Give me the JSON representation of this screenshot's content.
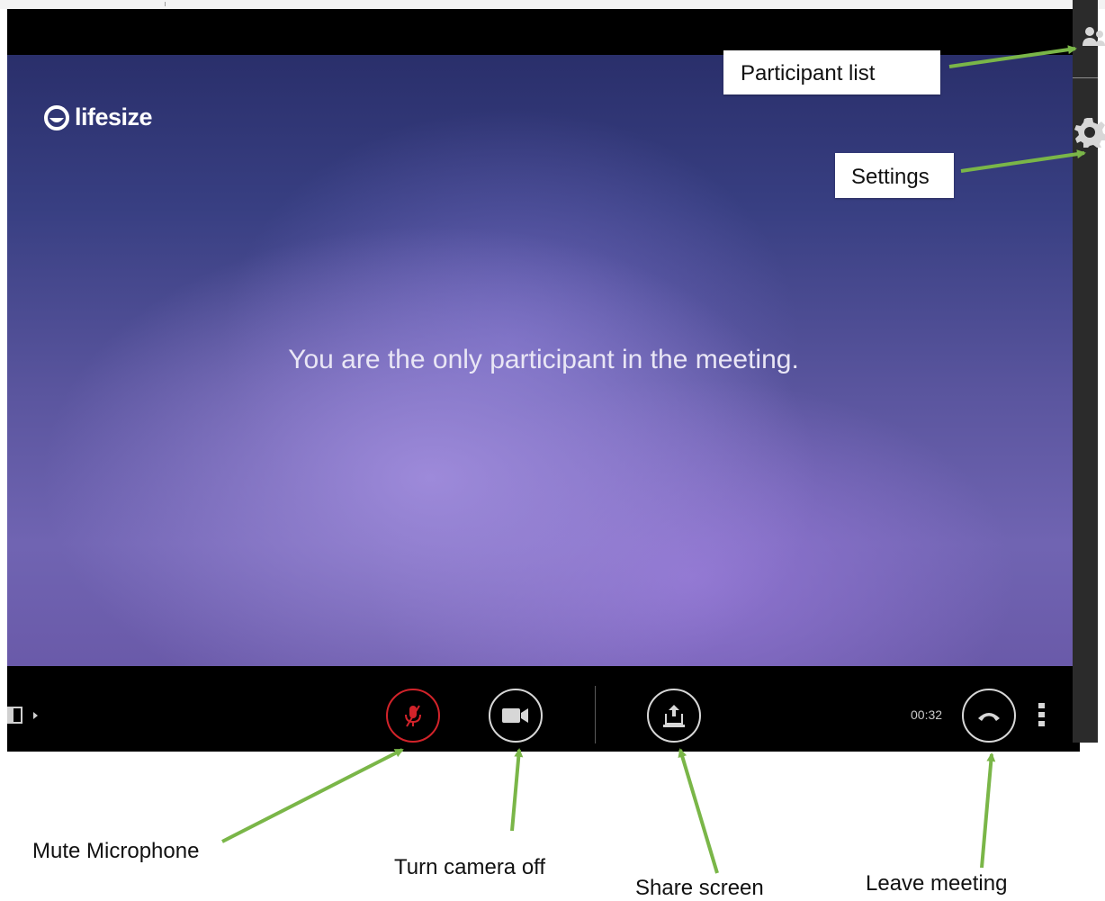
{
  "app": {
    "brand": "lifesize",
    "message": "You are the only participant in the meeting.",
    "timer": "00:32"
  },
  "controls": {
    "mic": {
      "icon": "microphone-muted-icon",
      "state": "muted",
      "accent": "#d2232a"
    },
    "camera": {
      "icon": "video-camera-icon"
    },
    "share": {
      "icon": "share-screen-icon"
    },
    "leave": {
      "icon": "hang-up-icon"
    },
    "more": {
      "icon": "vertical-ellipsis-icon"
    },
    "layout": {
      "icon": "layout-toggle-icon"
    }
  },
  "sidebar": {
    "participants": {
      "icon": "participants-icon"
    },
    "settings": {
      "icon": "gear-icon"
    }
  },
  "annotations": {
    "participant_list": "Participant list",
    "settings": "Settings",
    "mute_microphone": "Mute Microphone",
    "turn_camera_off": "Turn camera off",
    "share_screen": "Share screen",
    "leave_meeting": "Leave meeting",
    "arrow_color": "#7ab648"
  }
}
